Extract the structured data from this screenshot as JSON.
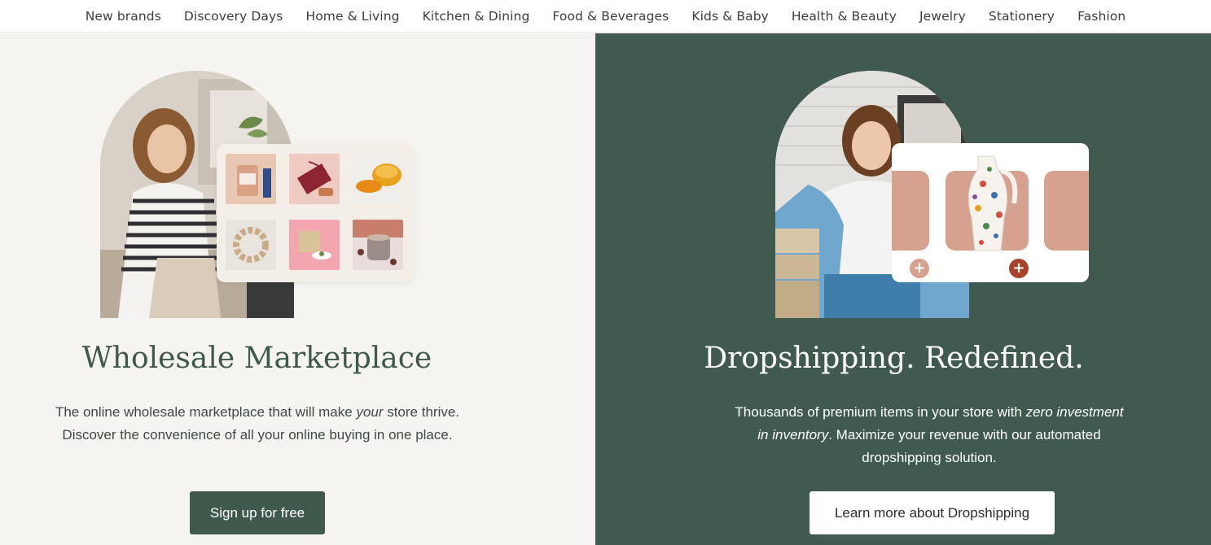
{
  "nav": {
    "items": [
      "New brands",
      "Discovery Days",
      "Home & Living",
      "Kitchen & Dining",
      "Food & Beverages",
      "Kids & Baby",
      "Health & Beauty",
      "Jewelry",
      "Stationery",
      "Fashion"
    ]
  },
  "left": {
    "title": "Wholesale Marketplace",
    "desc_part1": "The online wholesale marketplace that will make ",
    "desc_em": "your",
    "desc_part2": " store thrive. Discover the convenience of all your online buying in one place.",
    "button_label": "Sign up for free"
  },
  "right": {
    "title": "Dropshipping. Redefined.",
    "desc_part1": "Thousands of premium items in your store with ",
    "desc_em": "zero investment in inventory",
    "desc_part2": ". Maximize your revenue with our automated dropshipping solution.",
    "button_label": "Learn more about Dropshipping"
  },
  "colors": {
    "brand_green": "#405a4f",
    "cream": "#f5f4f0",
    "terracotta": "#d6a18e",
    "plus_dark": "#a8432b"
  },
  "icons": {
    "plus_left": "plus-icon",
    "plus_right": "plus-icon"
  }
}
